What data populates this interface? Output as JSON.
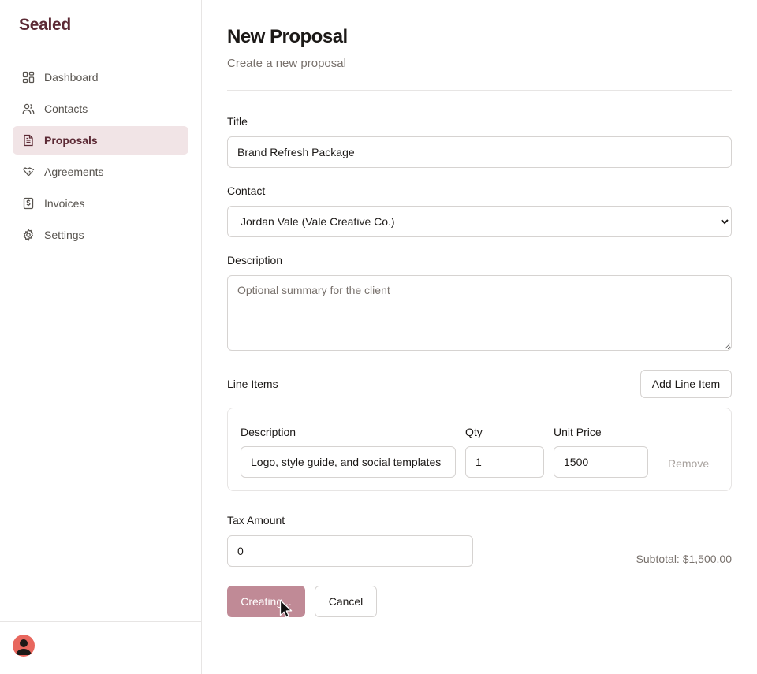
{
  "app": {
    "brand": "Sealed"
  },
  "sidebar": {
    "items": [
      {
        "label": "Dashboard",
        "icon": "dashboard-icon"
      },
      {
        "label": "Contacts",
        "icon": "users-icon"
      },
      {
        "label": "Proposals",
        "icon": "document-icon",
        "active": true
      },
      {
        "label": "Agreements",
        "icon": "handshake-icon"
      },
      {
        "label": "Invoices",
        "icon": "invoice-icon"
      },
      {
        "label": "Settings",
        "icon": "gear-icon"
      }
    ]
  },
  "page": {
    "title": "New Proposal",
    "subtitle": "Create a new proposal"
  },
  "form": {
    "title_label": "Title",
    "title_value": "Brand Refresh Package",
    "contact_label": "Contact",
    "contact_value": "Jordan Vale (Vale Creative Co.)",
    "description_label": "Description",
    "description_placeholder": "Optional summary for the client",
    "line_items_label": "Line Items",
    "add_line_item": "Add Line Item",
    "line_item": {
      "description_label": "Description",
      "qty_label": "Qty",
      "unit_price_label": "Unit Price",
      "description_value": "Logo, style guide, and social templates",
      "qty_value": "1",
      "unit_price_value": "1500",
      "remove_label": "Remove"
    },
    "tax_label": "Tax Amount",
    "tax_value": "0",
    "subtotal": "Subtotal: $1,500.00",
    "submit_label": "Creating...",
    "cancel_label": "Cancel"
  },
  "colors": {
    "brand": "#5c2a35",
    "active_bg": "#f1e4e6",
    "primary_disabled": "#c08a96",
    "avatar": "#e8675e"
  }
}
